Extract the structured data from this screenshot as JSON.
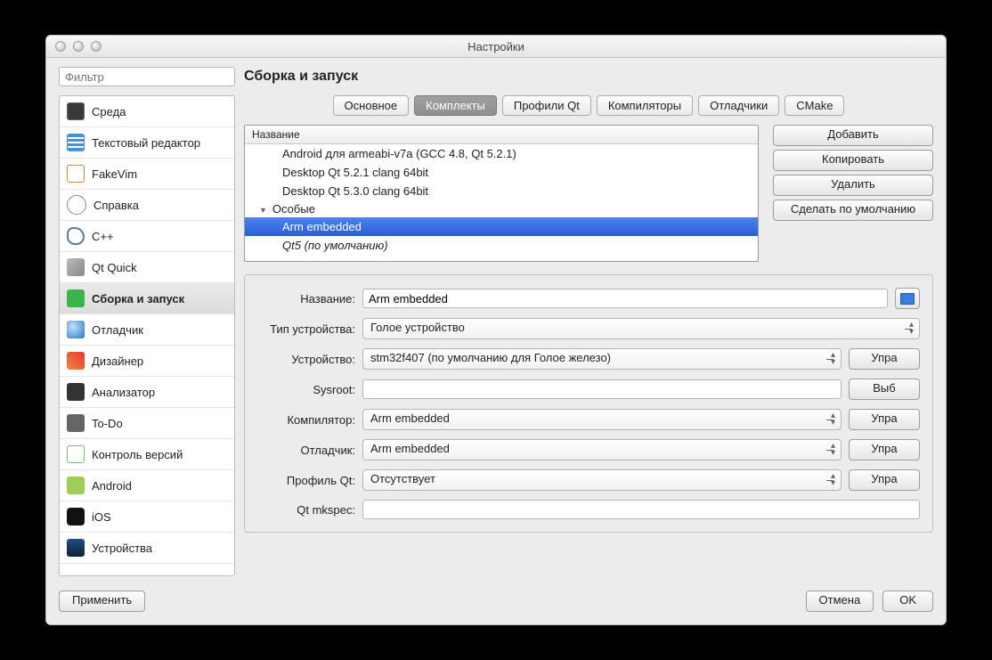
{
  "window": {
    "title": "Настройки"
  },
  "filter": {
    "placeholder": "Фильтр"
  },
  "page_title": "Сборка и запуск",
  "sidebar": {
    "items": [
      {
        "label": "Среда",
        "icon": "environment-icon"
      },
      {
        "label": "Текстовый редактор",
        "icon": "text-editor-icon"
      },
      {
        "label": "FakeVim",
        "icon": "fakevim-icon"
      },
      {
        "label": "Справка",
        "icon": "help-icon"
      },
      {
        "label": "C++",
        "icon": "cpp-icon"
      },
      {
        "label": "Qt Quick",
        "icon": "qtquick-icon"
      },
      {
        "label": "Сборка и запуск",
        "icon": "build-run-icon"
      },
      {
        "label": "Отладчик",
        "icon": "debugger-icon"
      },
      {
        "label": "Дизайнер",
        "icon": "designer-icon"
      },
      {
        "label": "Анализатор",
        "icon": "analyzer-icon"
      },
      {
        "label": "To-Do",
        "icon": "todo-icon"
      },
      {
        "label": "Контроль версий",
        "icon": "vcs-icon"
      },
      {
        "label": "Android",
        "icon": "android-icon"
      },
      {
        "label": "iOS",
        "icon": "ios-icon"
      },
      {
        "label": "Устройства",
        "icon": "devices-icon"
      }
    ],
    "selected_index": 6
  },
  "tabs": {
    "items": [
      "Основное",
      "Комплекты",
      "Профили Qt",
      "Компиляторы",
      "Отладчики",
      "CMake"
    ],
    "active_index": 1
  },
  "kits": {
    "header": "Название",
    "rows": [
      {
        "label": "Android для armeabi-v7a (GCC 4.8, Qt 5.2.1)"
      },
      {
        "label": "Desktop Qt 5.2.1 clang 64bit"
      },
      {
        "label": "Desktop Qt 5.3.0 clang 64bit"
      }
    ],
    "group": "Особые",
    "special": [
      {
        "label": "Arm embedded",
        "selected": true
      },
      {
        "label": "Qt5 (по умолчанию)",
        "default": true
      }
    ]
  },
  "actions": {
    "add": "Добавить",
    "copy": "Копировать",
    "delete": "Удалить",
    "make_default": "Сделать по умолчанию"
  },
  "form": {
    "name_label": "Название:",
    "name_value": "Arm embedded",
    "devtype_label": "Тип устройства:",
    "devtype_value": "Голое устройство",
    "device_label": "Устройство:",
    "device_value": "stm32f407 (по умолчанию для Голое железо)",
    "sysroot_label": "Sysroot:",
    "sysroot_value": "",
    "compiler_label": "Компилятор:",
    "compiler_value": "Arm embedded",
    "debugger_label": "Отладчик:",
    "debugger_value": "Arm embedded",
    "qtprofile_label": "Профиль Qt:",
    "qtprofile_value": "Отсутствует",
    "mkspec_label": "Qt mkspec:",
    "mkspec_value": "",
    "manage": "Упра",
    "browse": "Выб"
  },
  "bottom": {
    "apply": "Применить",
    "cancel": "Отмена",
    "ok": "OK"
  }
}
